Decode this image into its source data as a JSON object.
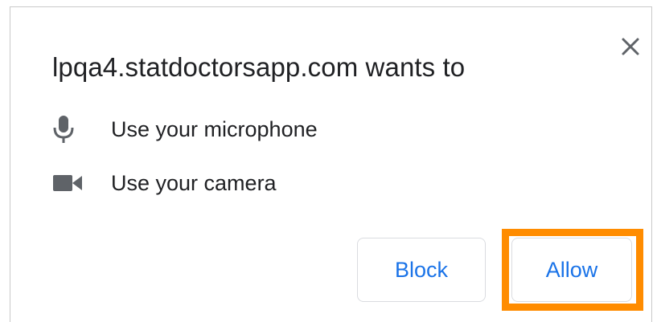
{
  "prompt": {
    "title": "lpqa4.statdoctorsapp.com wants to",
    "permissions": [
      {
        "icon": "microphone-icon",
        "label": "Use your microphone"
      },
      {
        "icon": "camera-icon",
        "label": "Use your camera"
      }
    ],
    "block_label": "Block",
    "allow_label": "Allow",
    "close_icon": "close-icon"
  },
  "colors": {
    "title_text": "#202124",
    "icon": "#5f6368",
    "button_text": "#1a73e8",
    "button_border": "#dadce0",
    "highlight": "#ff8c00"
  }
}
